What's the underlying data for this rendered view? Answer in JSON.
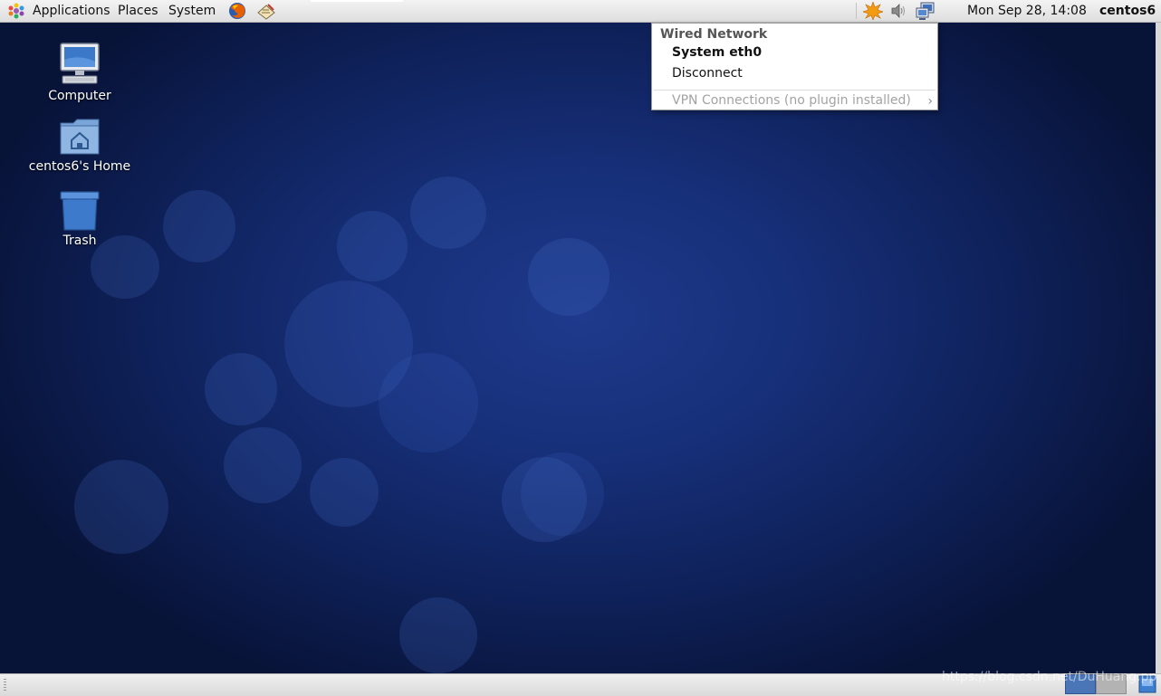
{
  "top_panel": {
    "menus": [
      "Applications",
      "Places",
      "System"
    ],
    "launchers": [
      "firefox-icon",
      "text-editor-icon"
    ],
    "tray_icons": [
      "update-notifier-icon",
      "volume-icon",
      "network-icon"
    ],
    "clock": "Mon Sep 28, 14:08",
    "user": "centos6"
  },
  "desktop": {
    "icons": [
      {
        "label": "Computer",
        "icon": "computer-icon"
      },
      {
        "label": "centos6's Home",
        "icon": "home-folder-icon"
      },
      {
        "label": "Trash",
        "icon": "trash-icon"
      }
    ]
  },
  "network_menu": {
    "header": "Wired Network",
    "connection": "System eth0",
    "disconnect": "Disconnect",
    "vpn": "VPN Connections (no plugin installed)"
  },
  "bottom_panel": {
    "watermark": "https://blog.csdn.net/DuHuang.pp"
  },
  "colors": {
    "panel": "#e6e6e6",
    "desktop_blue": "#17307a",
    "workspace_active": "#4a76b8",
    "workspace_inactive": "#b3b3b3"
  }
}
